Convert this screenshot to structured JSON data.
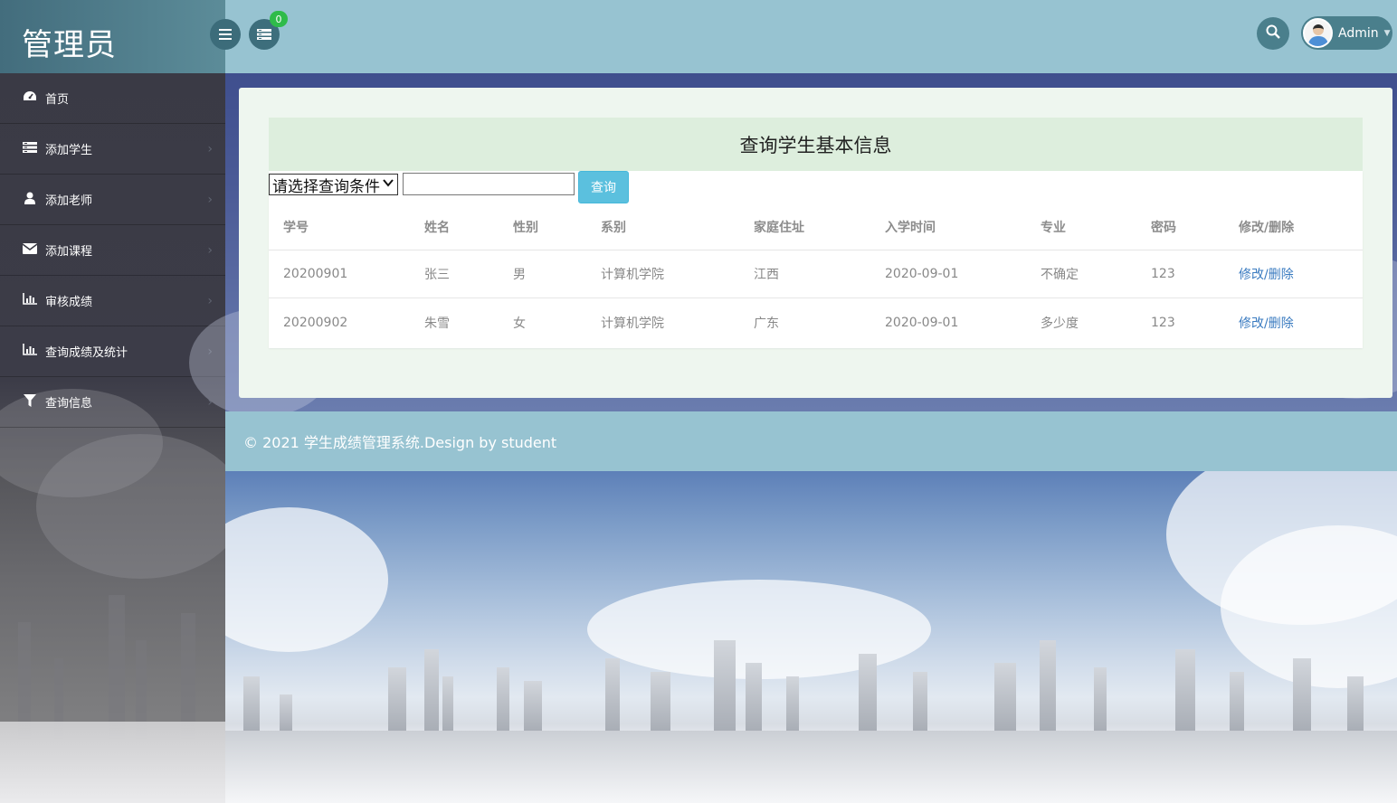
{
  "brand": {
    "title": "管理员"
  },
  "sidebar": {
    "items": [
      {
        "label": "首页",
        "icon": "dashboard-icon"
      },
      {
        "label": "添加学生",
        "icon": "list-icon"
      },
      {
        "label": "添加老师",
        "icon": "user-icon"
      },
      {
        "label": "添加课程",
        "icon": "envelope-icon"
      },
      {
        "label": "审核成绩",
        "icon": "bar-chart-icon"
      },
      {
        "label": "查询成绩及统计",
        "icon": "bar-chart-icon"
      },
      {
        "label": "查询信息",
        "icon": "filter-icon"
      }
    ]
  },
  "header": {
    "notification_count": "0",
    "user_name": "Admin"
  },
  "main": {
    "panel_title": "查询学生基本信息",
    "select_value": "请选择查询条件",
    "input_value": "",
    "query_button": "查询",
    "table": {
      "columns": [
        "学号",
        "姓名",
        "性别",
        "系别",
        "家庭住址",
        "入学时间",
        "专业",
        "密码",
        "修改/删除"
      ],
      "rows": [
        [
          "20200901",
          "张三",
          "男",
          "计算机学院",
          "江西",
          "2020-09-01",
          "不确定",
          "123",
          "修改/删除"
        ],
        [
          "20200902",
          "朱雪",
          "女",
          "计算机学院",
          "广东",
          "2020-09-01",
          "多少度",
          "123",
          "修改/删除"
        ]
      ]
    }
  },
  "footer": {
    "text": "© 2021 学生成绩管理系统.Design by student"
  },
  "colors": {
    "topbar": "#97c3d1",
    "brand": "#436d7d",
    "query_button": "#5bc0de",
    "link": "#3a7bc0",
    "badge": "#2fbb4a"
  }
}
